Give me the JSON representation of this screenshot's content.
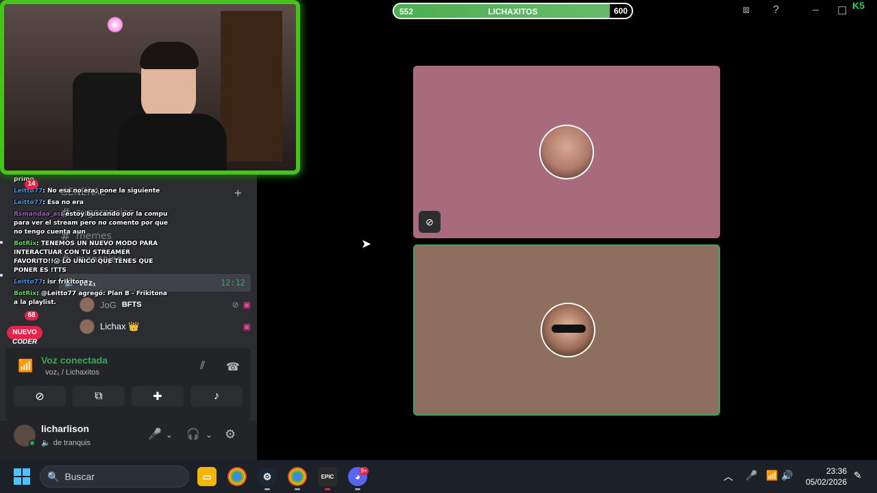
{
  "topbar": {
    "xp_left": "552",
    "xp_title": "LICHAXITOS",
    "xp_right": "600",
    "xp_progress": 0.92,
    "brand_badge": "K5"
  },
  "channels": [
    {
      "label": "GENERAL"
    },
    {
      "label": "sugerencias"
    },
    {
      "label": "memes"
    },
    {
      "label": "mensajes"
    }
  ],
  "voice_channel": {
    "name": "voz₁",
    "timer": "12:12",
    "users": [
      {
        "name": "JoG",
        "tag": "BFTS"
      },
      {
        "name": "Lichax 👑"
      }
    ]
  },
  "chat": {
    "messages": [
      {
        "user": "",
        "text": "primo",
        "color": "white"
      },
      {
        "user": "Leitto77",
        "text": ": No esa no era, pone la siguiente",
        "color": "blue"
      },
      {
        "user": "Leitto77",
        "text": ": Esa no era",
        "color": "blue"
      },
      {
        "user": "Rsmandaa_as",
        "text": ": estoy buscando por la compu para ver el stream pero no comento por que no tengo cuenta aun",
        "color": "purple"
      },
      {
        "user": "BotRix",
        "text": ": TENEMOS UN NUEVO MODO PARA INTERACTUAR CON TU STREAMER FAVORITO!!😱 LO UNICO QUE TENES QUE PONER ES !TTS",
        "color": "green"
      },
      {
        "user": "Leitto77",
        "text": ": isr frikitona",
        "color": "blue"
      },
      {
        "user": "BotRix",
        "text": ": @Leitto77 agregó: Plan B - Frikitona a la playlist.",
        "color": "green"
      }
    ],
    "badge_top": "14",
    "badge_bottom": "68",
    "new_button": "NUEVO",
    "footer_label": "CODER"
  },
  "voice_panel": {
    "title": "Voz conectada",
    "subtitle": "voz₁ / Lichaxitos"
  },
  "user_panel": {
    "name": "licharlison",
    "status": "de tranquis"
  },
  "taskbar": {
    "search_placeholder": "Buscar",
    "time": "23:36",
    "date": "05/02/2026",
    "discord_badge": "9+"
  },
  "colors": {
    "accent_green": "#3ba55d",
    "tile_pink": "#a86b7e",
    "tile_brown": "#8e6e5d",
    "xp_green": "#4caf50"
  }
}
